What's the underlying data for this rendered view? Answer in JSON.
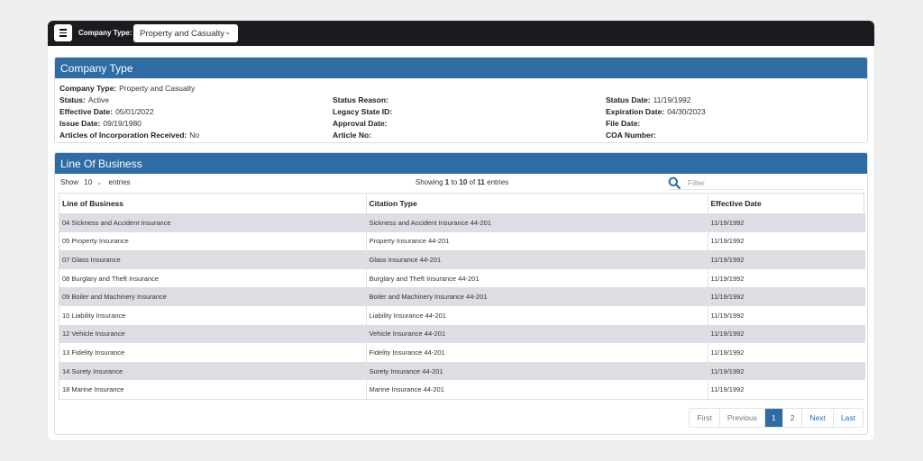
{
  "topbar": {
    "company_type_label": "Company Type:",
    "company_type_value": "Property and Casualty",
    "icon": "hamburger-menu-icon"
  },
  "company_panel": {
    "title": "Company Type",
    "col1": [
      {
        "k": "Company Type:",
        "v": "Property and Casualty"
      },
      {
        "k": "Status:",
        "v": "Active"
      },
      {
        "k": "Effective Date:",
        "v": "05/01/2022"
      },
      {
        "k": "Issue Date:",
        "v": "09/19/1980"
      },
      {
        "k": "Articles of Incorporation Received:",
        "v": "No"
      }
    ],
    "col2": [
      {
        "k": "Status Reason:",
        "v": ""
      },
      {
        "k": "Legacy State ID:",
        "v": ""
      },
      {
        "k": "Approval Date:",
        "v": ""
      },
      {
        "k": "Article No:",
        "v": ""
      }
    ],
    "col3": [
      {
        "k": "Status Date:",
        "v": "11/19/1992"
      },
      {
        "k": "Expiration Date:",
        "v": "04/30/2023"
      },
      {
        "k": "File Date:",
        "v": ""
      },
      {
        "k": "COA Number:",
        "v": ""
      }
    ]
  },
  "lob_panel": {
    "title": "Line Of Business",
    "show_prefix": "Show",
    "show_value": "10",
    "show_suffix": "entries",
    "info": {
      "pre": "Showing",
      "from": "1",
      "to_word": "to",
      "to": "10",
      "of_word": "of",
      "total": "11",
      "post": "entries"
    },
    "filter_placeholder": "Filter",
    "columns": [
      "Line of Business",
      "Citation Type",
      "Effective Date"
    ],
    "rows": [
      [
        "04 Sickness and Accident Insurance",
        "Sickness and Accident Insurance 44-201",
        "11/19/1992"
      ],
      [
        "05 Property Insurance",
        "Property Insurance 44-201",
        "11/19/1992"
      ],
      [
        "07 Glass Insurance",
        "Glass Insurance 44-201",
        "11/19/1992"
      ],
      [
        "08 Burglary and Theft Insurance",
        "Burglary and Theft Insurance 44-201",
        "11/19/1992"
      ],
      [
        "09 Boiler and Machinery Insurance",
        "Boiler and Machinery Insurance 44-201",
        "11/19/1992"
      ],
      [
        "10 Liability Insurance",
        "Liability Insurance 44-201",
        "11/19/1992"
      ],
      [
        "12 Vehicle Insurance",
        "Vehicle Insurance 44-201",
        "11/19/1992"
      ],
      [
        "13 Fidelity Insurance",
        "Fidelity Insurance 44-201",
        "11/19/1992"
      ],
      [
        "14 Surety Insurance",
        "Surety Insurance 44-201",
        "11/19/1992"
      ],
      [
        "18 Marine Insurance",
        "Marine Insurance 44-201",
        "11/19/1992"
      ]
    ],
    "pagination": {
      "first": "First",
      "previous": "Previous",
      "pages": [
        "1",
        "2"
      ],
      "current": "1",
      "next": "Next",
      "last": "Last"
    }
  },
  "colors": {
    "header_blue": "#2f6ca3",
    "topbar": "#1b1c20",
    "row_stripe": "#dddee3"
  }
}
